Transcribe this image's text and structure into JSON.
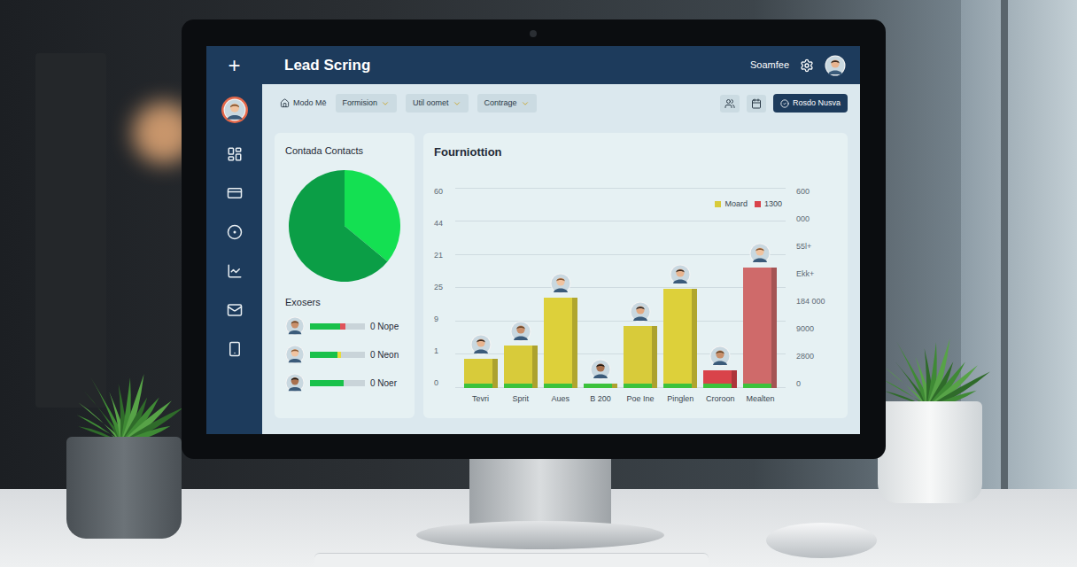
{
  "header": {
    "menu_glyph": "+",
    "title": "Lead Scring",
    "user": "Soamfee"
  },
  "toolbar": {
    "home": "Modo Mē",
    "filters": [
      {
        "label": "Formision"
      },
      {
        "label": "Util oomet"
      },
      {
        "label": "Contrage"
      }
    ],
    "action": "Rosdo Nusva"
  },
  "contacts_card": {
    "title": "Contada Contacts",
    "pie": [
      {
        "value": 36,
        "color": "#14e052"
      },
      {
        "value": 64,
        "color": "#0b9e46"
      }
    ],
    "section": "Exosers",
    "rows": [
      {
        "label": "0 Nope",
        "level": 0.55,
        "accent_level": 0.1,
        "color": "#e0525a"
      },
      {
        "label": "0 Neon",
        "level": 0.5,
        "accent_level": 0.06,
        "color": "#e8dc3a"
      },
      {
        "label": "0 Noer",
        "level": 0.62,
        "accent_level": 0,
        "color": "#c9d4d9"
      }
    ]
  },
  "chart": {
    "title": "Fourniottion",
    "y_ticks": [
      "60",
      "44",
      "21",
      "25",
      "9",
      "1",
      "0"
    ],
    "y2_ticks": [
      "600",
      "000",
      "55l+",
      "Ekk+",
      "184 000",
      "9000",
      "2800",
      "0"
    ],
    "legend": [
      {
        "label": "Moard",
        "color": "#d8cb3a"
      },
      {
        "label": "1300",
        "color": "#d9434a"
      }
    ],
    "categories": [
      "Tevri",
      "Sprit",
      "Aues",
      "B 200",
      "Poe Ine",
      "Pinglen",
      "Croroon",
      "Mealten"
    ],
    "series": [
      {
        "name": "Moard",
        "values": [
          16,
          20,
          34.5,
          5,
          26,
          37,
          12.5,
          43.5
        ]
      }
    ],
    "bar_colors": [
      "#d8cb3a",
      "#d8cb3a",
      "#ddd03a",
      "#d8cb3a",
      "#d8cb3a",
      "#ddd03a",
      "#d9434a",
      "#cf6a6a"
    ],
    "max": 60
  }
}
